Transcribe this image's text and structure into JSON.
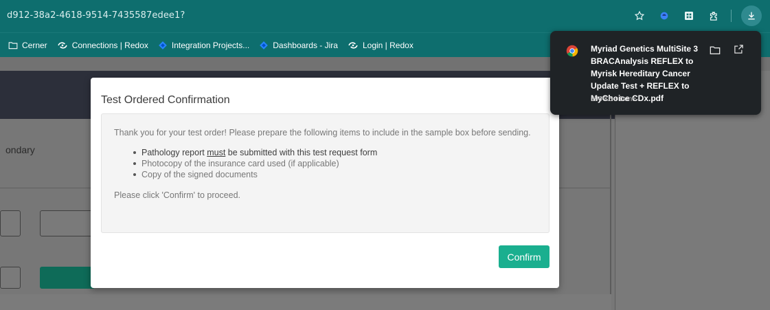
{
  "browser": {
    "url_fragment": "d912-38a2-4618-9514-7435587edee1?",
    "bookmarks": [
      {
        "label": "Cerner",
        "icon": "folder-icon"
      },
      {
        "label": "Connections | Redox",
        "icon": "redox-icon"
      },
      {
        "label": "Integration Projects...",
        "icon": "jira-icon"
      },
      {
        "label": "Dashboards - Jira",
        "icon": "jira-icon"
      },
      {
        "label": "Login | Redox",
        "icon": "redox-icon"
      }
    ]
  },
  "background_page": {
    "secondary_label": "ondary"
  },
  "download": {
    "file_name": "Myriad Genetics MultiSite 3 BRACAnalysis REFLEX to Myrisk Hereditary Cancer Update Test + REFLEX to MyChoice CDx.pdf",
    "meta": "696 KB • Done"
  },
  "modal": {
    "title": "Test Ordered Confirmation",
    "intro": "Thank you for your test order! Please prepare the following items to include in the sample box before sending.",
    "items": {
      "first_pre": "Pathology report ",
      "first_emph": "must",
      "first_post": " be submitted with this test request form",
      "second": "Photocopy of the insurance card used (if applicable)",
      "third": "Copy of the signed documents"
    },
    "proceed": "Please click 'Confirm' to proceed.",
    "confirm_label": "Confirm"
  },
  "colors": {
    "chrome_teal": "#0e6e6e",
    "confirm_green": "#1aaf8f",
    "popup_bg": "#1f2326"
  }
}
